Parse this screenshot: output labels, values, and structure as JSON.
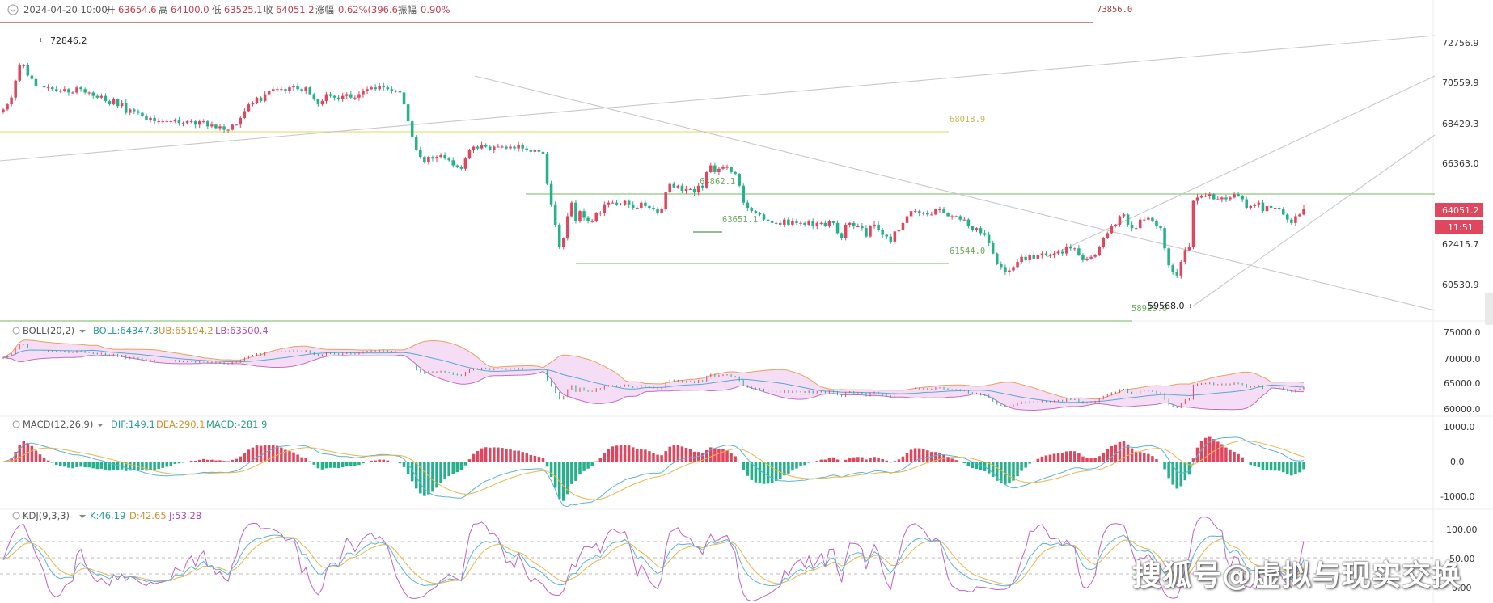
{
  "header": {
    "icon": "chevron-down-icon",
    "datetime": "2024-04-20 10:00",
    "open_label": "开",
    "open": "63654.6",
    "high_label": "高",
    "high": "64100.0",
    "low_label": "低",
    "low": "63525.1",
    "close_label": "收",
    "close": "64051.2",
    "change_label": "涨幅",
    "change": "0.62%(396.6)",
    "amp_label": "振幅",
    "amp": "0.90%"
  },
  "price_axis": {
    "ticks": [
      "72756.9",
      "70559.9",
      "68429.3",
      "66363.0",
      "64051.2",
      "62415.7",
      "60530.9"
    ],
    "last_price": "64051.2",
    "countdown": "11:51",
    "last_price_color": "#e0465e"
  },
  "annotations": {
    "top_high": "73856.0",
    "peak_label": "72846.2",
    "fib_1": "68018.9",
    "fib_2": "64862.1",
    "fib_3": "63651.1",
    "fib_4": "61544.0",
    "fib_5": "58926.0",
    "low_label": "59568.0"
  },
  "boll": {
    "title": "BOLL(20,2)",
    "boll_label": "BOLL:64347.3",
    "ub_label": "UB:65194.2",
    "lb_label": "LB:63500.4",
    "ticks": [
      "75000.0",
      "70000.0",
      "65000.0",
      "60000.0"
    ]
  },
  "macd": {
    "title": "MACD(12,26,9)",
    "dif_label": "DIF:149.1",
    "dea_label": "DEA:290.1",
    "macd_label": "MACD:-281.9",
    "ticks": [
      "1000.0",
      "0.0",
      "-1000.0"
    ]
  },
  "kdj": {
    "title": "KDJ(9,3,3)",
    "k_label": "K:46.19",
    "d_label": "D:42.65",
    "j_label": "J:53.28",
    "ticks": [
      "100.00",
      "50.00",
      "0.00"
    ]
  },
  "colors": {
    "up": "#e0465e",
    "down": "#25b28a",
    "boll_mid": "#5aa7d6",
    "boll_ub": "#e8a060",
    "boll_lb": "#c070c0",
    "boll_fill": "#f3d6f3",
    "dif": "#5ab4d6",
    "dea": "#e8b54a",
    "k": "#5ab4d6",
    "d": "#e8b54a",
    "j": "#c060c8",
    "hline_yellow": "#e8e090",
    "hline_green": "#8cc87c",
    "trend_gray": "#c8c8c8",
    "top_line": "#a04040"
  },
  "watermark": "搜狐号@虚拟与现实交换",
  "chart_data": {
    "type": "candlestick",
    "interval_hint": "4h",
    "price_range": [
      58000,
      74000
    ],
    "closes": [
      69900,
      70200,
      70600,
      71600,
      72500,
      72500,
      71900,
      71700,
      71300,
      71300,
      71200,
      71200,
      71100,
      71000,
      71000,
      71100,
      70900,
      70900,
      71200,
      71100,
      70900,
      70900,
      70700,
      70600,
      70700,
      70400,
      70200,
      70500,
      70100,
      70300,
      69700,
      69900,
      69800,
      69700,
      69500,
      69300,
      69400,
      69200,
      69200,
      69200,
      69200,
      69200,
      69300,
      69100,
      69100,
      69200,
      69200,
      69000,
      69200,
      69200,
      68900,
      69000,
      68800,
      68900,
      68700,
      68700,
      69000,
      69000,
      69400,
      69800,
      70200,
      70300,
      70600,
      70400,
      70800,
      71000,
      71100,
      71100,
      71100,
      71000,
      71200,
      71300,
      71100,
      71000,
      71200,
      70800,
      70500,
      70200,
      70400,
      70800,
      70700,
      70600,
      70500,
      70700,
      70800,
      70600,
      70600,
      70800,
      71000,
      71100,
      71200,
      71100,
      71300,
      71200,
      71100,
      71000,
      71000,
      70900,
      70200,
      69200,
      68300,
      67500,
      67100,
      66800,
      67100,
      67000,
      67100,
      67200,
      67000,
      66900,
      66600,
      66500,
      66400,
      67000,
      67500,
      67700,
      67600,
      67800,
      67700,
      67500,
      67700,
      67700,
      67700,
      67600,
      67700,
      67600,
      67800,
      67600,
      67500,
      67400,
      67500,
      67400,
      67300,
      65500,
      64300,
      63100,
      61800,
      62300,
      63600,
      64400,
      63300,
      63900,
      63500,
      63300,
      63300,
      63800,
      63800,
      64300,
      64400,
      64400,
      64300,
      64300,
      64500,
      64300,
      64100,
      64100,
      64400,
      64200,
      64100,
      64000,
      63800,
      64000,
      65000,
      65500,
      65300,
      65400,
      65100,
      65200,
      65200,
      65000,
      65400,
      65300,
      66200,
      66600,
      66200,
      66400,
      66500,
      66500,
      66200,
      66100,
      65400,
      64400,
      64100,
      63900,
      63800,
      63700,
      63400,
      63300,
      63200,
      63200,
      63100,
      63400,
      63100,
      63300,
      63200,
      63200,
      63100,
      63300,
      63000,
      63200,
      63200,
      63000,
      63300,
      63200,
      62600,
      62300,
      63100,
      63200,
      63000,
      63000,
      62900,
      62400,
      63000,
      63100,
      62800,
      62500,
      62400,
      62100,
      62700,
      62800,
      63200,
      63600,
      63900,
      63900,
      63800,
      63800,
      63700,
      63700,
      64000,
      64000,
      63800,
      63600,
      63600,
      63600,
      63400,
      63400,
      63000,
      62800,
      62900,
      62600,
      62500,
      62000,
      61400,
      60800,
      60600,
      60300,
      60400,
      60600,
      60900,
      61200,
      61000,
      61300,
      61100,
      61300,
      61400,
      61300,
      61300,
      61400,
      61500,
      61400,
      61800,
      61700,
      61700,
      61300,
      61000,
      61100,
      61200,
      61300,
      61800,
      62300,
      62600,
      63000,
      63100,
      63600,
      63700,
      63100,
      62900,
      62900,
      63400,
      63400,
      63500,
      63300,
      63000,
      62900,
      61700,
      60700,
      60300,
      60100,
      60900,
      61600,
      61800,
      64500,
      64700,
      64800,
      64800,
      64900,
      64600,
      64600,
      64700,
      64600,
      64700,
      64900,
      64800,
      64600,
      64100,
      64200,
      64300,
      64400,
      63900,
      64200,
      64100,
      64100,
      64000,
      63700,
      63400,
      63200,
      63600,
      63700,
      64051.2
    ]
  }
}
